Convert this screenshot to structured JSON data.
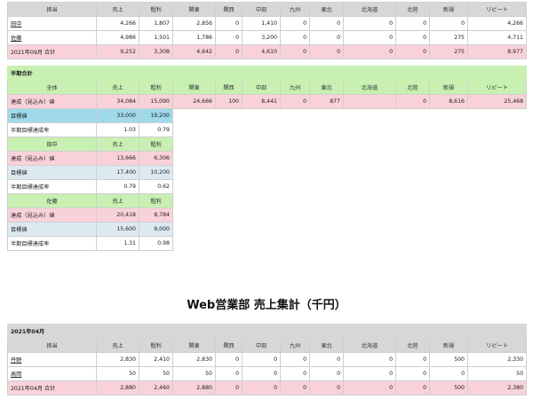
{
  "columns": [
    "担当",
    "売上",
    "粗利",
    "関東",
    "関西",
    "中部",
    "九州",
    "東北",
    "北海道",
    "北陸",
    "新規",
    "リピート"
  ],
  "top": {
    "rows": [
      {
        "name": "田中",
        "cells": [
          "4,266",
          "1,807",
          "2,856",
          "0",
          "1,410",
          "0",
          "0",
          "0",
          "0",
          "0",
          "4,266"
        ]
      },
      {
        "name": "佐藤",
        "cells": [
          "4,986",
          "1,501",
          "1,786",
          "0",
          "3,200",
          "0",
          "0",
          "0",
          "0",
          "275",
          "4,711"
        ]
      }
    ],
    "total": {
      "name": "2021年09月 合計",
      "cells": [
        "9,252",
        "3,308",
        "4,642",
        "0",
        "4,610",
        "0",
        "0",
        "0",
        "0",
        "275",
        "8,977"
      ]
    }
  },
  "half": {
    "section_label": "半期合計",
    "all": {
      "header": [
        "全体",
        "売上",
        "粗利",
        "関東",
        "関西",
        "中部",
        "九州",
        "東北",
        "北海道",
        "北陸",
        "新規",
        "リピート"
      ],
      "achieved": {
        "label": "達成（見込み）値",
        "cells": [
          "34,084",
          "15,090",
          "24,666",
          "100",
          "8,441",
          "0",
          "877",
          "",
          "0",
          "8,616",
          "25,468"
        ]
      },
      "target": {
        "label": "目標値",
        "cells": [
          "33,000",
          "19,200"
        ]
      },
      "rate": {
        "label": "半期目標達成率",
        "cells": [
          "1.03",
          "0.79"
        ]
      }
    },
    "people": [
      {
        "header": [
          "田中",
          "売上",
          "粗利"
        ],
        "achieved": {
          "label": "達成（見込み）値",
          "cells": [
            "13,666",
            "6,306"
          ]
        },
        "target": {
          "label": "目標値",
          "cells": [
            "17,400",
            "10,200"
          ]
        },
        "rate": {
          "label": "半期目標達成率",
          "cells": [
            "0.79",
            "0.62"
          ]
        }
      },
      {
        "header": [
          "佐藤",
          "売上",
          "粗利"
        ],
        "achieved": {
          "label": "達成（見込み）値",
          "cells": [
            "20,418",
            "8,784"
          ]
        },
        "target": {
          "label": "目標値",
          "cells": [
            "15,600",
            "9,000"
          ]
        },
        "rate": {
          "label": "半期目標達成率",
          "cells": [
            "1.31",
            "0.98"
          ]
        }
      }
    ]
  },
  "web": {
    "title": "Web営業部 売上集計（千円）",
    "month_label": "2021年04月",
    "rows": [
      {
        "name": "丹野",
        "cells": [
          "2,830",
          "2,410",
          "2,830",
          "0",
          "0",
          "0",
          "0",
          "0",
          "0",
          "500",
          "2,330"
        ]
      },
      {
        "name": "高岡",
        "cells": [
          "50",
          "50",
          "50",
          "0",
          "0",
          "0",
          "0",
          "0",
          "0",
          "0",
          "50"
        ]
      }
    ],
    "total": {
      "name": "2021年04月 合計",
      "cells": [
        "2,880",
        "2,460",
        "2,880",
        "0",
        "0",
        "0",
        "0",
        "0",
        "0",
        "500",
        "2,380"
      ]
    }
  }
}
